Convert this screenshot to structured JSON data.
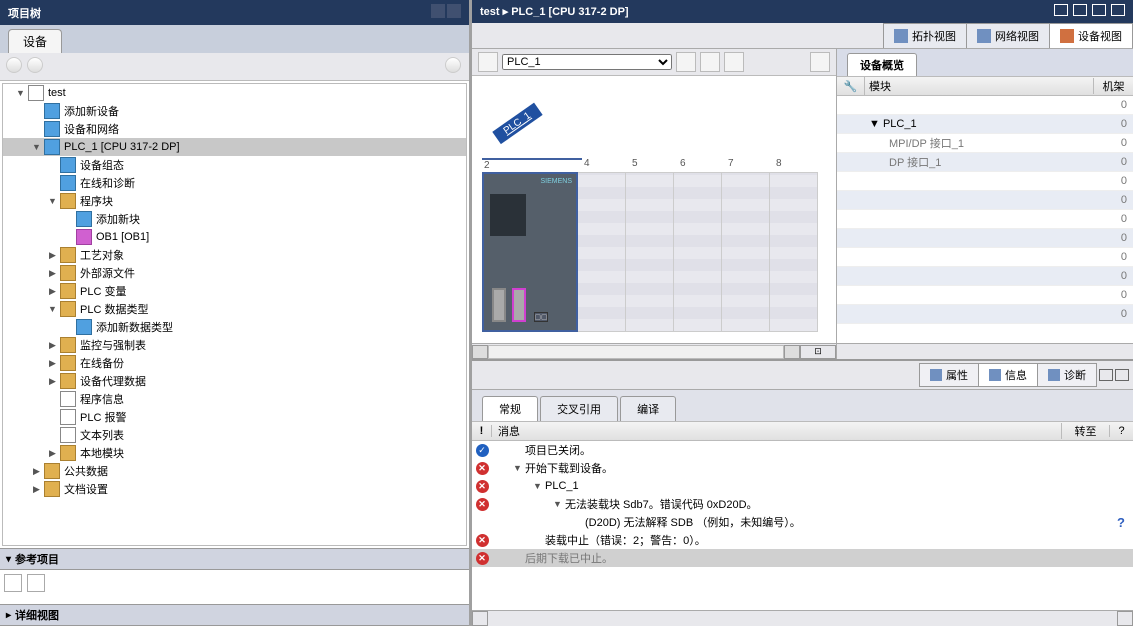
{
  "left": {
    "title": "项目树",
    "tab": "设备",
    "tree": [
      {
        "d": 0,
        "e": "▼",
        "i": "ico-doc",
        "t": "test"
      },
      {
        "d": 1,
        "e": "",
        "i": "ico-dev",
        "t": "添加新设备"
      },
      {
        "d": 1,
        "e": "",
        "i": "ico-dev",
        "t": "设备和网络"
      },
      {
        "d": 1,
        "e": "▼",
        "i": "ico-dev",
        "t": "PLC_1 [CPU 317-2 DP]",
        "sel": true
      },
      {
        "d": 2,
        "e": "",
        "i": "ico-dev",
        "t": "设备组态"
      },
      {
        "d": 2,
        "e": "",
        "i": "ico-dev",
        "t": "在线和诊断"
      },
      {
        "d": 2,
        "e": "▼",
        "i": "ico-fold",
        "t": "程序块"
      },
      {
        "d": 3,
        "e": "",
        "i": "ico-dev",
        "t": "添加新块"
      },
      {
        "d": 3,
        "e": "",
        "i": "ico-blk",
        "t": "OB1 [OB1]"
      },
      {
        "d": 2,
        "e": "▶",
        "i": "ico-fold",
        "t": "工艺对象"
      },
      {
        "d": 2,
        "e": "▶",
        "i": "ico-fold",
        "t": "外部源文件"
      },
      {
        "d": 2,
        "e": "▶",
        "i": "ico-fold",
        "t": "PLC 变量"
      },
      {
        "d": 2,
        "e": "▼",
        "i": "ico-fold",
        "t": "PLC 数据类型"
      },
      {
        "d": 3,
        "e": "",
        "i": "ico-dev",
        "t": "添加新数据类型"
      },
      {
        "d": 2,
        "e": "▶",
        "i": "ico-fold",
        "t": "监控与强制表"
      },
      {
        "d": 2,
        "e": "▶",
        "i": "ico-fold",
        "t": "在线备份"
      },
      {
        "d": 2,
        "e": "▶",
        "i": "ico-fold",
        "t": "设备代理数据"
      },
      {
        "d": 2,
        "e": "",
        "i": "ico-doc",
        "t": "程序信息"
      },
      {
        "d": 2,
        "e": "",
        "i": "ico-doc",
        "t": "PLC 报警"
      },
      {
        "d": 2,
        "e": "",
        "i": "ico-doc",
        "t": "文本列表"
      },
      {
        "d": 2,
        "e": "▶",
        "i": "ico-fold",
        "t": "本地模块"
      },
      {
        "d": 1,
        "e": "▶",
        "i": "ico-fold",
        "t": "公共数据"
      },
      {
        "d": 1,
        "e": "▶",
        "i": "ico-fold",
        "t": "文档设置"
      }
    ],
    "ref_title": "参考项目",
    "detail_title": "详细视图"
  },
  "right": {
    "breadcrumb": "test  ▸  PLC_1 [CPU 317-2 DP]",
    "viewtabs": {
      "topo": "拓扑视图",
      "net": "网络视图",
      "dev": "设备视图"
    },
    "device_sel": "PLC_1",
    "plc_label": "PLC_1",
    "siemens": "SIEMENS",
    "slots": [
      "2",
      "4",
      "5",
      "6",
      "7",
      "8"
    ],
    "ov_tab": "设备概览",
    "ov_hdr": {
      "mod": "模块",
      "rack": "机架"
    },
    "ov_rows": [
      {
        "alt": false,
        "d": 0,
        "t": "",
        "v": "0"
      },
      {
        "alt": true,
        "d": 0,
        "t": "▼  PLC_1",
        "v": "0",
        "strong": true
      },
      {
        "alt": false,
        "d": 1,
        "t": "MPI/DP 接口_1",
        "v": "0"
      },
      {
        "alt": true,
        "d": 1,
        "t": "DP 接口_1",
        "v": "0"
      },
      {
        "alt": false,
        "d": 0,
        "t": "",
        "v": "0"
      },
      {
        "alt": true,
        "d": 0,
        "t": "",
        "v": "0"
      },
      {
        "alt": false,
        "d": 0,
        "t": "",
        "v": "0"
      },
      {
        "alt": true,
        "d": 0,
        "t": "",
        "v": "0"
      },
      {
        "alt": false,
        "d": 0,
        "t": "",
        "v": "0"
      },
      {
        "alt": true,
        "d": 0,
        "t": "",
        "v": "0"
      },
      {
        "alt": false,
        "d": 0,
        "t": "",
        "v": "0"
      },
      {
        "alt": true,
        "d": 0,
        "t": "",
        "v": "0"
      }
    ],
    "insp": {
      "prop": "属性",
      "info": "信息",
      "diag": "诊断"
    },
    "sub": {
      "gen": "常规",
      "cross": "交叉引用",
      "comp": "编译"
    },
    "msg_hdr": {
      "bang": "!",
      "msg": "消息",
      "goto": "转至",
      "q": "?"
    },
    "msgs": [
      {
        "ic": "ok",
        "d": 1,
        "e": "",
        "t": "项目已关闭。"
      },
      {
        "ic": "err",
        "d": 1,
        "e": "▼",
        "t": "开始下载到设备。"
      },
      {
        "ic": "err",
        "d": 2,
        "e": "▼",
        "t": "PLC_1"
      },
      {
        "ic": "err",
        "d": 3,
        "e": "▼",
        "t": "无法装载块 Sdb7。错误代码 0xD20D。"
      },
      {
        "ic": "",
        "d": 4,
        "e": "",
        "t": "(D20D) 无法解释 SDB （例如，未知编号）。",
        "q": "?"
      },
      {
        "ic": "err",
        "d": 2,
        "e": "",
        "t": "装载中止（错误：2；警告：0）。"
      },
      {
        "ic": "err",
        "d": 1,
        "e": "",
        "t": "后期下载已中止。",
        "sel": true
      }
    ]
  }
}
